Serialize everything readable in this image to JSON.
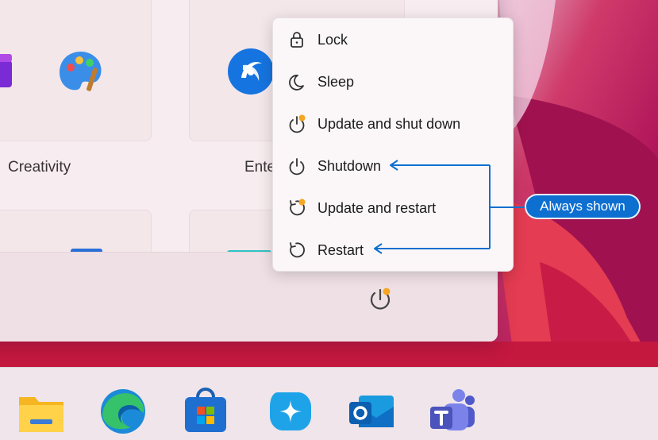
{
  "start_menu": {
    "categories": [
      "Creativity",
      "Ente"
    ]
  },
  "power_menu": {
    "items": [
      {
        "label": "Lock",
        "icon": "lock-icon"
      },
      {
        "label": "Sleep",
        "icon": "moon-icon"
      },
      {
        "label": "Update and shut down",
        "icon": "update-shutdown-icon"
      },
      {
        "label": "Shutdown",
        "icon": "power-icon"
      },
      {
        "label": "Update and restart",
        "icon": "update-restart-icon"
      },
      {
        "label": "Restart",
        "icon": "restart-icon"
      }
    ]
  },
  "callout": {
    "label": "Always shown"
  },
  "taskbar": {
    "apps": [
      "file-explorer-icon",
      "edge-icon",
      "store-icon",
      "copilot-icon",
      "outlook-icon",
      "teams-icon"
    ]
  },
  "colors": {
    "accent": "#0d6fd0",
    "update_dot": "#f5a623",
    "wallpaper_red": "#d8244a",
    "wallpaper_magenta": "#a3135f"
  }
}
